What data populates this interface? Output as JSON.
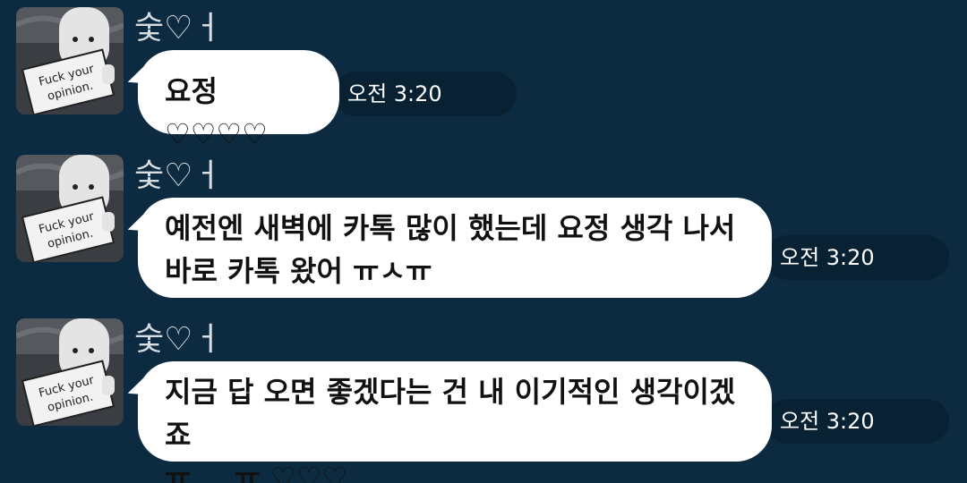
{
  "messages": [
    {
      "sender": "숯♡ㅓ",
      "avatar_text": [
        "Fuck your",
        "opinion."
      ],
      "text": "요정♡♡♡♡",
      "time": "오전 3:20"
    },
    {
      "sender": "숯♡ㅓ",
      "avatar_text": [
        "Fuck your",
        "opinion."
      ],
      "text": "예전엔 새벽에 카톡 많이 했는데 요정 생각 나서\n바로 카톡 왔어 ㅠㅅㅠ",
      "time": "오전 3:20"
    },
    {
      "sender": "숯♡ㅓ",
      "avatar_text": [
        "Fuck your",
        "opinion."
      ],
      "text": "지금 답 오면 좋겠다는 건 내 이기적인 생각이겠죠\nㅠ___ㅠ ♡♡♡",
      "time": "오전 3:20"
    }
  ],
  "colors": {
    "background": "#0d2b40",
    "bubble": "#ffffff",
    "time_pill": "#082234",
    "sender_text": "#d8dde2"
  },
  "icons": {
    "avatar": "cartoon-character-holding-sign"
  }
}
